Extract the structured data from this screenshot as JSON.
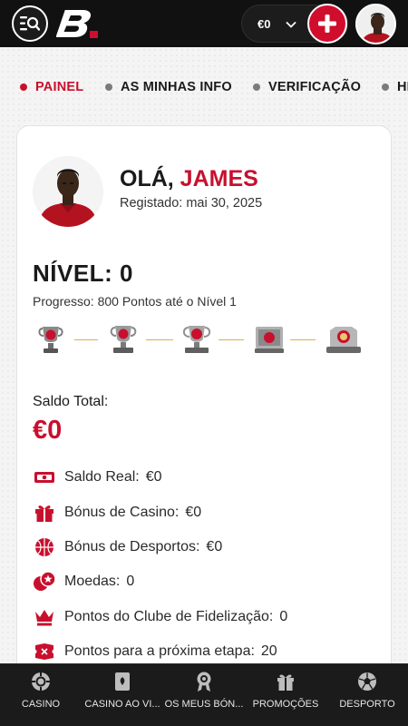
{
  "header": {
    "wallet_amount": "€0",
    "colors": {
      "background": "#111111",
      "brand_red": "#c8102e"
    }
  },
  "tabs": [
    {
      "label": "PAINEL",
      "active": true
    },
    {
      "label": "AS MINHAS INFO",
      "active": false
    },
    {
      "label": "VERIFICAÇÃO",
      "active": false
    },
    {
      "label": "HI",
      "active": false
    }
  ],
  "profile": {
    "greeting": "OLÁ,",
    "name": "JAMES",
    "registered": "Registado: mai 30, 2025"
  },
  "level": {
    "title": "NÍVEL: 0",
    "progress": "Progresso: 800 Pontos até o Nível 1",
    "trophy_icons": [
      "trophy-level-1-icon",
      "trophy-level-2-icon",
      "trophy-level-3-icon",
      "trophy-level-4-icon",
      "trophy-level-5-icon"
    ]
  },
  "balance": {
    "total_label": "Saldo Total:",
    "total_value": "€0",
    "rows": [
      {
        "icon": "cash-icon",
        "label": "Saldo Real:",
        "value": "€0"
      },
      {
        "icon": "gift-icon",
        "label": "Bónus de Casino:",
        "value": "€0"
      },
      {
        "icon": "basketball-icon",
        "label": "Bónus de Desportos:",
        "value": "€0"
      },
      {
        "icon": "coins-icon",
        "label": "Moedas:",
        "value": "0"
      },
      {
        "icon": "crown-icon",
        "label": "Pontos do Clube de Fidelização:",
        "value": "0"
      },
      {
        "icon": "ticket-icon",
        "label": "Pontos para a próxima etapa:",
        "value": "20"
      }
    ]
  },
  "bottom_nav": [
    {
      "icon": "casino-chip-icon",
      "label": "CASINO"
    },
    {
      "icon": "playing-card-icon",
      "label": "CASINO AO VI..."
    },
    {
      "icon": "award-icon",
      "label": "OS MEUS BÓN..."
    },
    {
      "icon": "gift-icon",
      "label": "PROMOÇÕES"
    },
    {
      "icon": "soccer-ball-icon",
      "label": "DESPORTO"
    }
  ]
}
